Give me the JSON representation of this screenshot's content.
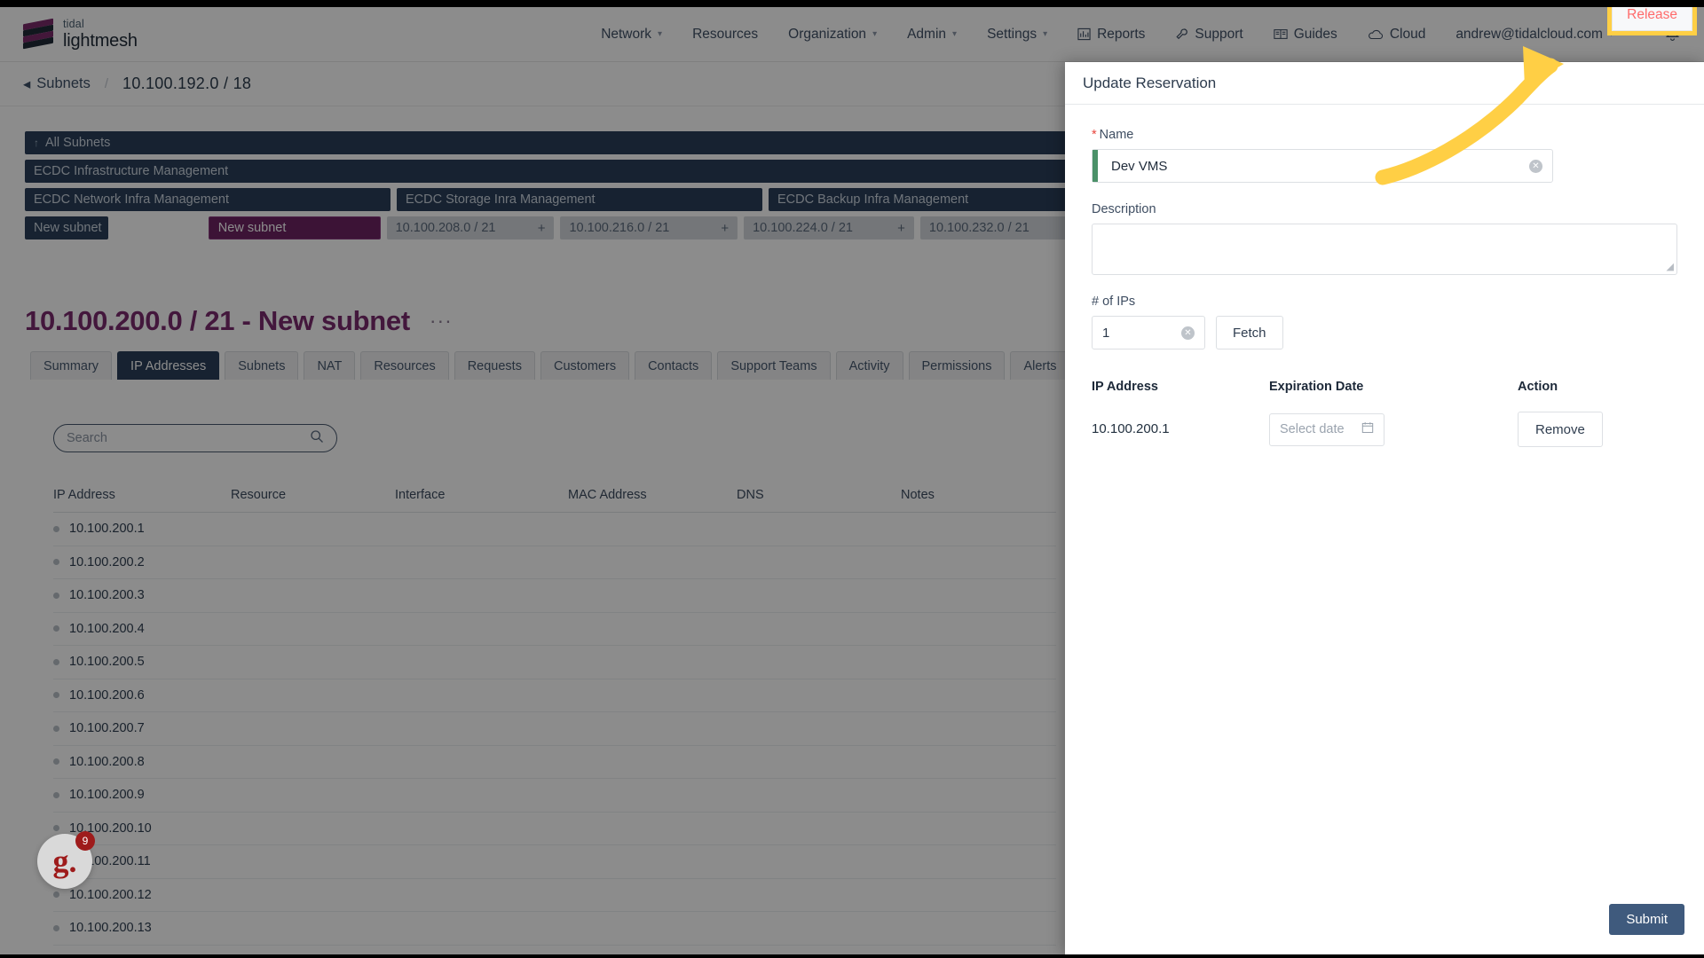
{
  "brand": {
    "top": "tidal",
    "bottom": "lightmesh"
  },
  "nav": {
    "items": [
      {
        "label": "Network",
        "caret": true,
        "icon": null
      },
      {
        "label": "Resources",
        "caret": false,
        "icon": null
      },
      {
        "label": "Organization",
        "caret": true,
        "icon": null
      },
      {
        "label": "Admin",
        "caret": true,
        "icon": null
      },
      {
        "label": "Settings",
        "caret": true,
        "icon": null
      },
      {
        "label": "Reports",
        "caret": false,
        "icon": "chart-bar-icon"
      },
      {
        "label": "Support",
        "caret": false,
        "icon": "wrench-icon"
      },
      {
        "label": "Guides",
        "caret": false,
        "icon": "book-icon"
      },
      {
        "label": "Cloud",
        "caret": false,
        "icon": "cloud-icon"
      },
      {
        "label": "andrew@tidalcloud.com",
        "caret": true,
        "icon": null
      }
    ],
    "notifications_icon": "bell-icon"
  },
  "breadcrumb": {
    "back_label": "Subnets",
    "separator": "/",
    "current": "10.100.192.0 / 18"
  },
  "tree": {
    "row1": [
      {
        "label": "All Subnets",
        "style": "plain",
        "uparrow": "↑"
      }
    ],
    "row2": [
      {
        "label": "ECDC Infrastructure Management",
        "style": "plain"
      }
    ],
    "row3": [
      {
        "label": "ECDC Network Infra Management",
        "style": "plain"
      },
      {
        "label": "ECDC Storage Inra Management",
        "style": "plain"
      },
      {
        "label": "ECDC Backup Infra Management",
        "style": "plain"
      }
    ],
    "row4": [
      {
        "label": "New subnet",
        "style": "plain"
      },
      {
        "label": "New subnet",
        "style": "selected"
      },
      {
        "label": "10.100.208.0 / 21",
        "style": "ghost",
        "plus": "+"
      },
      {
        "label": "10.100.216.0 / 21",
        "style": "ghost",
        "plus": "+"
      },
      {
        "label": "10.100.224.0 / 21",
        "style": "ghost",
        "plus": "+"
      },
      {
        "label": "10.100.232.0 / 21",
        "style": "ghost",
        "plus": "+"
      }
    ]
  },
  "page": {
    "title": "10.100.200.0 / 21 - New subnet",
    "overflow_menu": "···"
  },
  "tabs": [
    {
      "label": "Summary",
      "active": false
    },
    {
      "label": "IP Addresses",
      "active": true
    },
    {
      "label": "Subnets",
      "active": false
    },
    {
      "label": "NAT",
      "active": false
    },
    {
      "label": "Resources",
      "active": false
    },
    {
      "label": "Requests",
      "active": false
    },
    {
      "label": "Customers",
      "active": false
    },
    {
      "label": "Contacts",
      "active": false
    },
    {
      "label": "Support Teams",
      "active": false
    },
    {
      "label": "Activity",
      "active": false
    },
    {
      "label": "Permissions",
      "active": false
    },
    {
      "label": "Alerts",
      "active": false
    }
  ],
  "search": {
    "placeholder": "Search",
    "value": "",
    "icon": "search-icon"
  },
  "table": {
    "columns": [
      "IP Address",
      "Resource",
      "Interface",
      "MAC Address",
      "DNS",
      "Notes"
    ],
    "rows": [
      {
        "ip": "10.100.200.1"
      },
      {
        "ip": "10.100.200.2"
      },
      {
        "ip": "10.100.200.3"
      },
      {
        "ip": "10.100.200.4"
      },
      {
        "ip": "10.100.200.5"
      },
      {
        "ip": "10.100.200.6"
      },
      {
        "ip": "10.100.200.7"
      },
      {
        "ip": "10.100.200.8"
      },
      {
        "ip": "10.100.200.9"
      },
      {
        "ip": "10.100.200.10"
      },
      {
        "ip": "10.100.200.11"
      },
      {
        "ip": "10.100.200.12"
      },
      {
        "ip": "10.100.200.13"
      }
    ]
  },
  "drawer": {
    "title": "Update Reservation",
    "release_label": "Release",
    "name": {
      "label": "Name",
      "required_marker": "*",
      "value": "Dev VMS",
      "clear_icon": "clear-circle-icon"
    },
    "description": {
      "label": "Description",
      "value": ""
    },
    "num_ips": {
      "label": "# of IPs",
      "value": "1",
      "fetch_label": "Fetch",
      "clear_icon": "clear-circle-icon"
    },
    "reservation_table": {
      "columns": [
        "IP Address",
        "Expiration Date",
        "Action"
      ],
      "rows": [
        {
          "ip": "10.100.200.1",
          "date_placeholder": "Select date",
          "action_label": "Remove"
        }
      ]
    },
    "submit_label": "Submit"
  },
  "widget": {
    "letter": "g.",
    "badge": "9"
  },
  "colors": {
    "brand_purple": "#7a2a6e",
    "nav_text": "#415066",
    "tree_node": "#2a3f59",
    "selected_node": "#6d2463",
    "release_text": "#ff6b6b",
    "highlight_yellow": "#ffcf45",
    "submit_blue": "#3f5a7d",
    "name_accent_green": "#4b9169"
  }
}
